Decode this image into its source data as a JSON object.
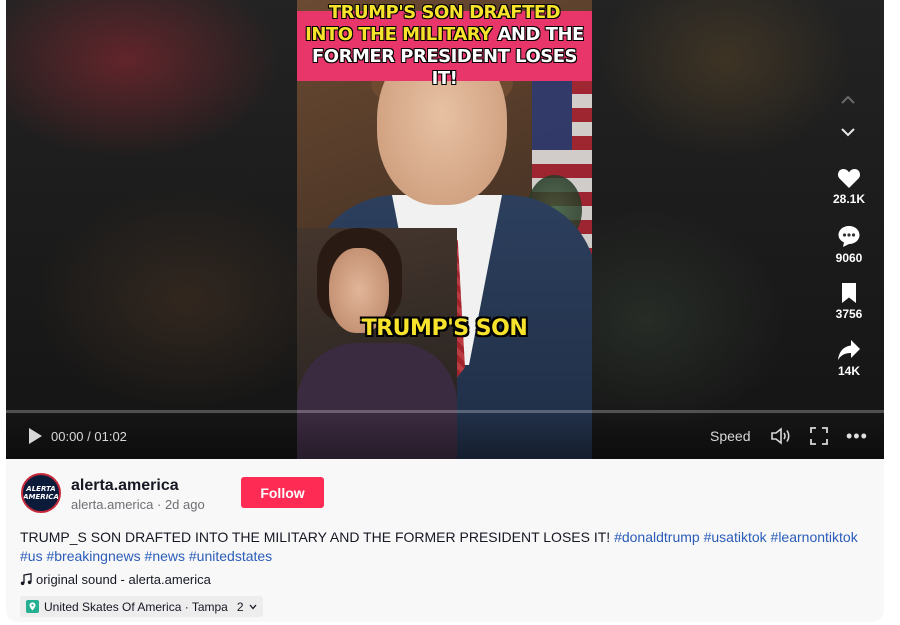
{
  "video": {
    "title_overlay_part1": "TRUMP'S SON DRAFTED INTO THE MILITARY",
    "title_overlay_part2": "AND THE FORMER PRESIDENT LOSES IT!",
    "caption_overlay": "TRUMP'S SON",
    "time": "00:00 / 01:02",
    "speed_label": "Speed",
    "progress": 0
  },
  "actions": {
    "likes": "28.1K",
    "comments": "9060",
    "saves": "3756",
    "shares": "14K"
  },
  "author": {
    "username": "alerta.america",
    "handle": "alerta.america",
    "posted": "2d ago",
    "avatar_text": "ALERTA AMERICA",
    "follow_label": "Follow"
  },
  "description": {
    "text": "TRUMP_S SON DRAFTED INTO THE MILITARY AND THE FORMER PRESIDENT LOSES IT!",
    "hashtags": [
      "#donaldtrump",
      "#usatiktok",
      "#learnontiktok",
      "#us",
      "#breakingnews",
      "#news",
      "#unitedstates"
    ]
  },
  "sound": {
    "label": "original sound - alerta.america"
  },
  "location": {
    "label": "United Skates Of America · Tampa",
    "count": "2"
  },
  "colors": {
    "accent": "#fe2c55",
    "hashtag": "#2b5db9",
    "overlay_title_bg": "#e8366b",
    "caption_yellow": "#f7e32b"
  },
  "icons": [
    "play-icon",
    "volume-icon",
    "fullscreen-icon",
    "more-icon",
    "chevron-up-icon",
    "chevron-down-icon",
    "heart-icon",
    "comment-icon",
    "bookmark-icon",
    "share-icon",
    "music-note-icon",
    "location-pin-icon"
  ]
}
